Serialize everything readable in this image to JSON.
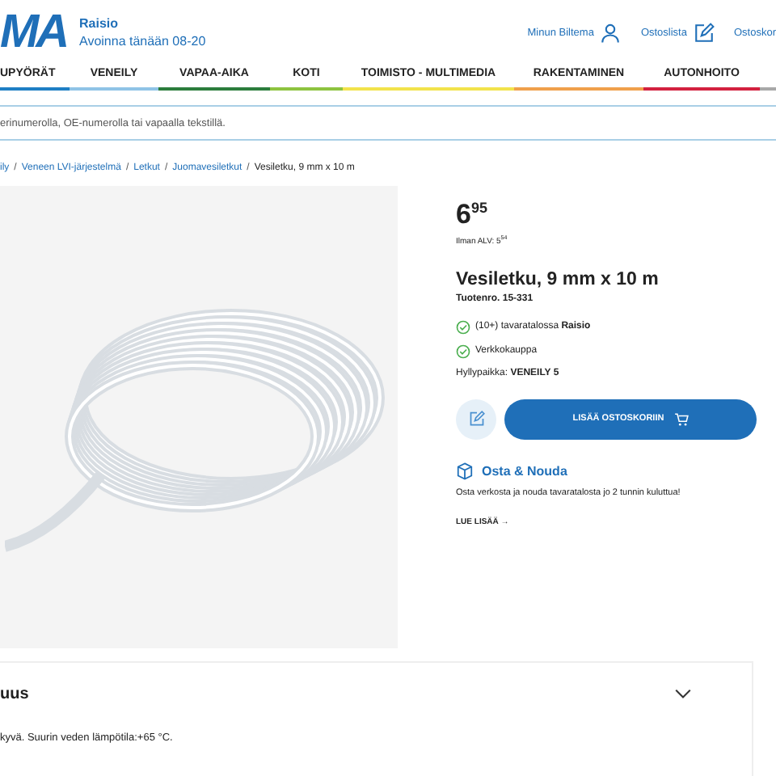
{
  "header": {
    "logo": "MA",
    "store": "Raisio",
    "hours": "Avoinna tänään 08-20",
    "links": [
      "Minun Biltema",
      "Ostoslista",
      "Ostoskor"
    ]
  },
  "nav": [
    {
      "label": "UPYÖRÄT",
      "color": "#1f7fc4"
    },
    {
      "label": "VENEILY",
      "color": "#8fc3e6"
    },
    {
      "label": "VAPAA-AIKA",
      "color": "#2b7d3c"
    },
    {
      "label": "KOTI",
      "color": "#8dc33f"
    },
    {
      "label": "TOIMISTO - MULTIMEDIA",
      "color": "#f2e34c"
    },
    {
      "label": "RAKENTAMINEN",
      "color": "#f0a04b"
    },
    {
      "label": "AUTONHOITO",
      "color": "#d3213f"
    }
  ],
  "search": {
    "placeholder": "erinumerolla, OE-numerolla tai vapaalla tekstillä."
  },
  "breadcrumb_separator": "/",
  "breadcrumb": [
    "ily",
    "Veneen LVI-järjestelmä",
    "Letkut",
    "Juomavesiletkut",
    "Vesiletku, 9 mm x 10 m"
  ],
  "product": {
    "price": "6$^{95}$",
    "price_ex_vat": "Ilman ALV:  5$^{54}$",
    "title": "Vesiletku, 9 mm x 10 m",
    "number": "Tuotenro. 15-331",
    "stock": [
      {
        "text": "(10+) tavaratalossa **Raisio**",
        "available": true
      },
      {
        "text": "Verkkokauppa",
        "available": true
      }
    ],
    "shelf": "Hyllypaikka: **VENEILY 5**",
    "add_button": "LISÄÄ OSTOSKORIIN",
    "pickup": {
      "title": "Osta & Nouda",
      "text": "Osta verkosta ja nouda tavaratalosta jo 2 tunnin kuluttua!",
      "link": "LUE LISÄÄ →"
    }
  },
  "description": {
    "title": "uus",
    "expanded": true,
    "text": "kyvä. Suurin veden lämpötila:+65 °C."
  }
}
